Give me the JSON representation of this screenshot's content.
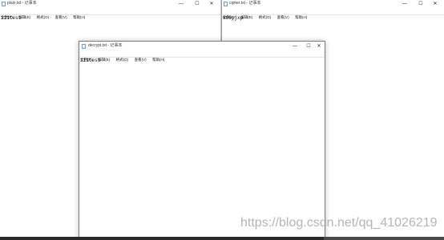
{
  "windows": {
    "plain": {
      "title": "plain.txt - 记事本",
      "menu": [
        "文件(F)",
        "编辑(E)",
        "格式(O)",
        "查看(V)",
        "帮助(H)"
      ],
      "content": "111test"
    },
    "cipher": {
      "title": "cipher.txt - 记事本",
      "menu": [
        "文件(F)",
        "编辑(E)",
        "格式(O)",
        "查看(V)",
        "帮助(H)"
      ],
      "content": "666yjxp"
    },
    "decrypt": {
      "title": "decrypt.txt - 记事本",
      "menu": [
        "文件(F)",
        "编辑(E)",
        "格式(O)",
        "查看(V)",
        "帮助(H)"
      ],
      "content": "111test"
    }
  },
  "controls": {
    "minimize": "—",
    "maximize": "☐",
    "close": "✕"
  },
  "watermark": "https://blog.csdn.net/qq_41026219",
  "colors": {
    "window_bg": "#ffffff",
    "border": "#7a7a7a",
    "icon": "#6a9fd4"
  }
}
